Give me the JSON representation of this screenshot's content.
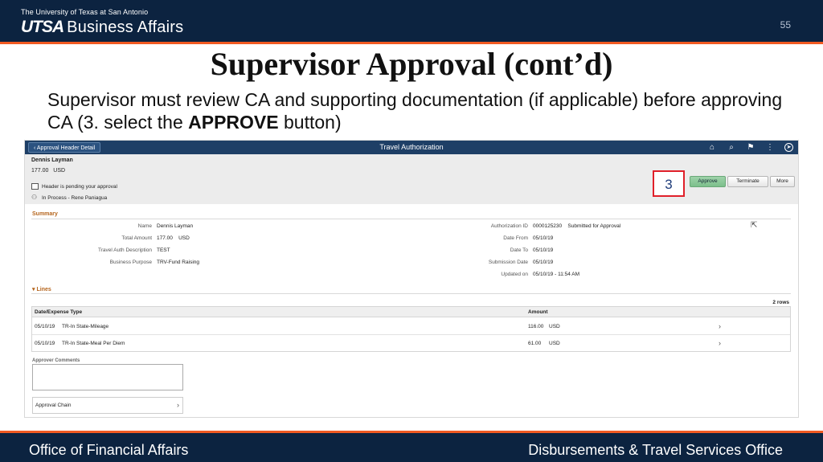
{
  "slide": {
    "university": "The University of Texas at San Antonio",
    "logo_utsa": "UTSA",
    "logo_unit": "Business Affairs",
    "page_number": "55",
    "title": "Supervisor Approval (cont’d)",
    "desc_part1": "Supervisor must review CA and supporting documentation (if applicable) before approving CA (3. select the ",
    "desc_bold": "APPROVE",
    "desc_part2": " button)",
    "callout_number": "3",
    "footer_left": "Office of Financial Affairs",
    "footer_right": "Disbursements & Travel Services Office",
    "colors": {
      "navy": "#0c2340",
      "orange": "#f15a22",
      "callout_red": "#e0202a"
    }
  },
  "app": {
    "back_label": "Approval Header Detail",
    "title": "Travel Authorization",
    "icons": [
      "home-icon",
      "search-icon",
      "flag-icon",
      "more-vertical-icon",
      "compass-icon"
    ],
    "employee_name": "Dennis Layman",
    "header_amount": "177.00",
    "header_currency": "USD",
    "status_pending": "Header is pending your approval",
    "status_in_process": "In Process - Rene Paniagua",
    "buttons": {
      "approve": "Approve",
      "terminate": "Terminate",
      "more": "More"
    },
    "summary": {
      "heading": "Summary",
      "left": [
        {
          "label": "Name",
          "value": "Dennis Layman"
        },
        {
          "label": "Total Amount",
          "value": "177.00    USD"
        },
        {
          "label": "Travel Auth Description",
          "value": "TEST"
        },
        {
          "label": "Business Purpose",
          "value": "TRV-Fund Raising"
        }
      ],
      "right": [
        {
          "label": "Authorization ID",
          "value": "0000125230    Submitted for Approval"
        },
        {
          "label": "Date From",
          "value": "05/10/19"
        },
        {
          "label": "Date To",
          "value": "05/10/19"
        },
        {
          "label": "Submission Date",
          "value": "05/10/19"
        },
        {
          "label": "Updated on",
          "value": "05/10/19 - 11:54 AM"
        }
      ]
    },
    "lines": {
      "heading": "Lines",
      "rows_count": "2 rows",
      "columns": [
        "Date/Expense Type",
        "Amount"
      ],
      "rows": [
        {
          "date": "05/10/19",
          "type": "TR-In State-Mileage",
          "amount": "116.00",
          "currency": "USD"
        },
        {
          "date": "05/10/19",
          "type": "TR-In State-Meal Per Diem",
          "amount": "61.00",
          "currency": "USD"
        }
      ]
    },
    "approver_comments_label": "Approver Comments",
    "approval_chain_label": "Approval Chain"
  }
}
